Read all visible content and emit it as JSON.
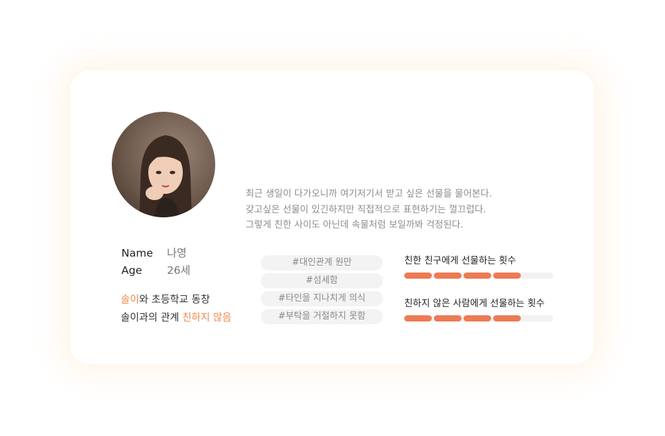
{
  "profile": {
    "avatar_alt": "",
    "description": [
      "최근 생일이 다가오니까 여기저기서 받고 싶은 선물을 물어본다.",
      "갖고싶은 선물이 있긴하지만 직접적으로 표현하기는 껄끄럽다.",
      "그렇게 친한 사이도 아닌데 속물처럼 보일까봐 걱정된다."
    ],
    "name_label": "Name",
    "name_value": "나영",
    "age_label": "Age",
    "age_value": "26세",
    "relation_line1_accent": "솔이",
    "relation_line1_rest": "와 초등학교 동창",
    "relation_line2_rest": "솔이과의 관계 ",
    "relation_line2_accent": "친하지 않음"
  },
  "tags": [
    "#대인관계 원만",
    "#섬세함",
    "#타인을 지나치게 의식",
    "#부탁을 거절하지 못함"
  ],
  "stats": [
    {
      "label": "친한 친구에게 선물하는 횟수",
      "value": 4,
      "max": 5
    },
    {
      "label": "친하지 않은 사람에게 선물하는 횟수",
      "value": 4,
      "max": 5
    }
  ],
  "colors": {
    "accent": "#ef8a4a",
    "bar": "#ec7b54",
    "track": "#f2f2f2"
  }
}
